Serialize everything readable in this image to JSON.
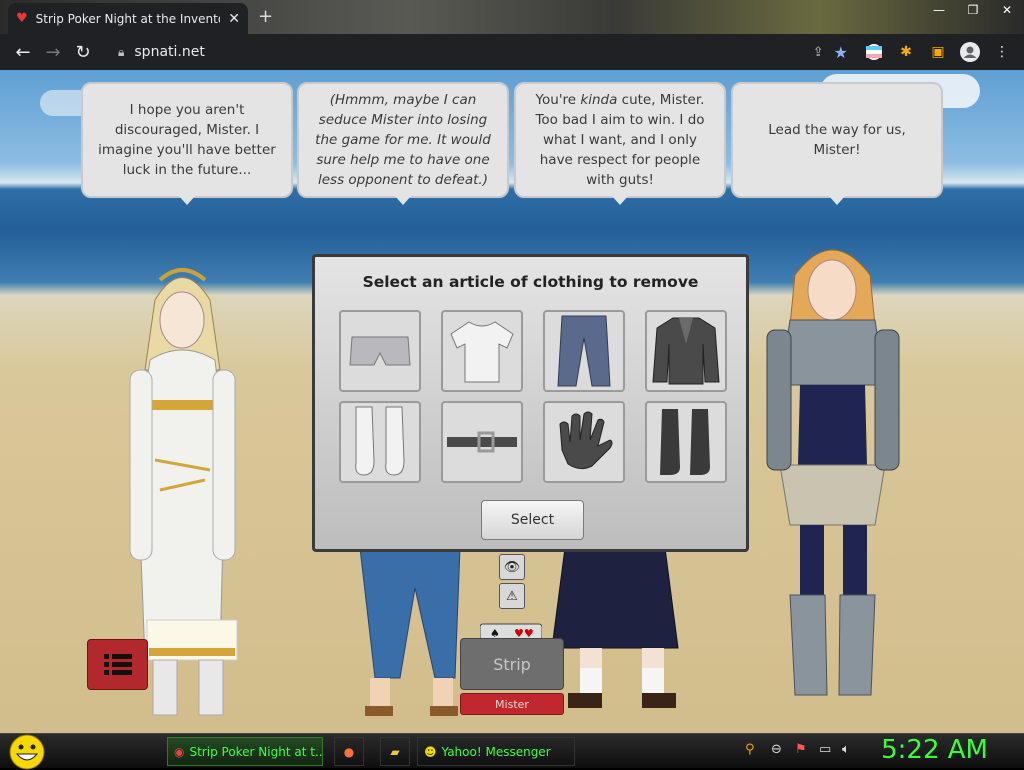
{
  "browser": {
    "tab_title": "Strip Poker Night at the Inventory",
    "url": "spnati.net",
    "new_tab": "+",
    "close_tab": "✕"
  },
  "window_controls": {
    "minimize": "—",
    "restore": "❐",
    "close": "✕"
  },
  "bubbles": [
    {
      "text": "I hope you aren't discouraged, Mister. I imagine you'll have better luck in the future...",
      "italic": false
    },
    {
      "text": "(Hmmm, maybe I can seduce Mister into losing the game for me. It would sure help me to have one less opponent to defeat.)",
      "italic": true
    },
    {
      "text_pre": "You're ",
      "text_em": "kinda",
      "text_post": " cute, Mister. Too bad I aim to win. I do what I want, and I only have respect for people with guts!"
    },
    {
      "text": "Lead the way for us, Mister!",
      "italic": false
    }
  ],
  "modal": {
    "title": "Select an article of clothing to remove",
    "items": [
      "boxers",
      "t-shirt",
      "jeans",
      "jacket",
      "socks",
      "belt",
      "gloves",
      "boots"
    ],
    "select_label": "Select"
  },
  "controls": {
    "strip_label": "Strip",
    "player_name": "Mister"
  },
  "taskbar": {
    "tasks": [
      {
        "label": "Strip Poker Night at t...",
        "icon": "chrome-icon"
      },
      {
        "label": "",
        "icon": "firefox-icon"
      },
      {
        "label": "",
        "icon": "folder-icon"
      },
      {
        "label": "Yahoo! Messenger",
        "icon": "yahoo-messenger-icon"
      }
    ],
    "clock": "5:22 AM"
  },
  "colors": {
    "accent_green": "#3cff3c",
    "menu_red": "#b3282d",
    "modal_bg": "#d0d0d0"
  }
}
